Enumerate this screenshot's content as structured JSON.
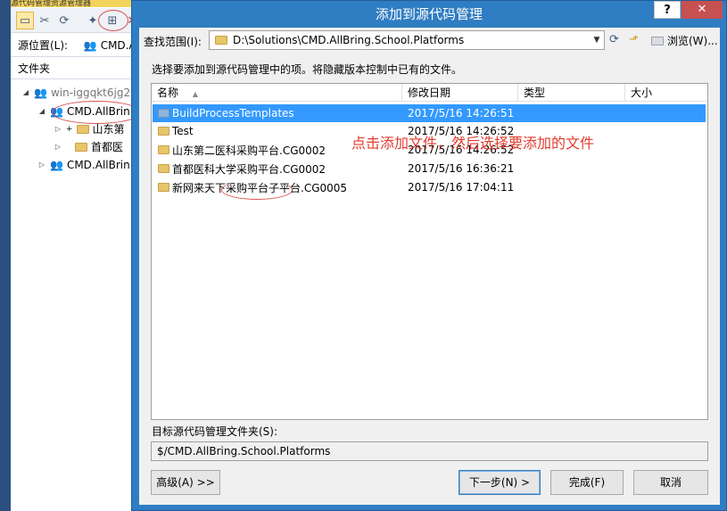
{
  "background_window": {
    "title": "源代码管理资源管理器",
    "source_label": "源位置(L):",
    "source_value": "CMD.A",
    "folders_label": "文件夹",
    "tree": [
      {
        "label": "win-iggqkt6jg2",
        "icon": "server-icon",
        "expanded": true
      },
      {
        "label": "CMD.AllBrin",
        "icon": "team-project-icon",
        "expanded": true
      },
      {
        "label": "山东第",
        "icon": "folder-icon",
        "expanded": false
      },
      {
        "label": "首都医",
        "icon": "folder-icon",
        "expanded": false
      },
      {
        "label": "CMD.AllBrin",
        "icon": "team-project-icon",
        "expanded": false
      }
    ]
  },
  "dialog": {
    "title": "添加到源代码管理",
    "help_label": "?",
    "close_label": "✕",
    "lookin_label": "查找范围(I):",
    "lookin_value": "D:\\Solutions\\CMD.AllBring.School.Platforms",
    "browse_label": "浏览(W)...",
    "hint": "选择要添加到源代码管理中的项。将隐藏版本控制中已有的文件。",
    "columns": [
      "名称",
      "修改日期",
      "类型",
      "大小"
    ],
    "rows": [
      {
        "name": "BuildProcessTemplates",
        "date": "2017/5/16 14:26:51",
        "selected": true
      },
      {
        "name": "Test",
        "date": "2017/5/16 14:26:52",
        "selected": false
      },
      {
        "name": "山东第二医科采购平台.CG0002",
        "date": "2017/5/16 14:26:52",
        "selected": false
      },
      {
        "name": "首都医科大学采购平台.CG0002",
        "date": "2017/5/16 16:36:21",
        "selected": false
      },
      {
        "name": "新网来天下采购平台子平台.CG0005",
        "date": "2017/5/16 17:04:11",
        "selected": false
      }
    ],
    "annotation": "点击添加文件，然后选择要添加的文件",
    "target_label": "目标源代码管理文件夹(S):",
    "target_value": "$/CMD.AllBring.School.Platforms",
    "buttons": {
      "advanced": "高级(A) >>",
      "next": "下一步(N) >",
      "finish": "完成(F)",
      "cancel": "取消"
    }
  },
  "colors": {
    "dialog_frame": "#2f7dc2",
    "selection": "#3399ff",
    "annotation": "#e23b2e"
  }
}
